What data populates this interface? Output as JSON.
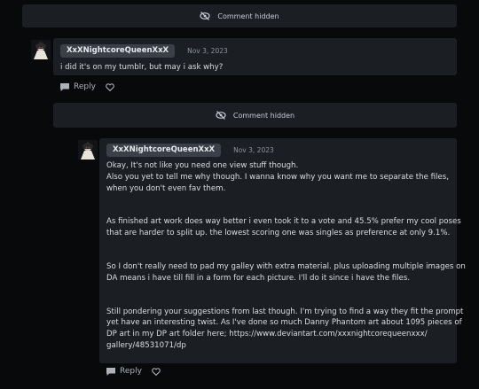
{
  "hidden_bar_1": {
    "label": "Comment hidden"
  },
  "comment_1": {
    "username": "XxXNightcoreQueenXxX",
    "date": "Nov 3, 2023",
    "text": "i did it's on my tumblr, but may i ask why?",
    "reply_label": "Reply"
  },
  "hidden_bar_2": {
    "label": "Comment hidden"
  },
  "comment_2": {
    "username": "XxXNightcoreQueenXxX",
    "date": "Nov 3, 2023",
    "paragraphs": [
      {
        "lines": [
          "Okay, It's not like you need one view stuff though.",
          "Also you yet to tell me why though. I wanna know why you want me to separate the files,",
          "when you don't even fav them."
        ]
      },
      {
        "lines": [
          "As finished art work does way better i even took it to a vote and 45.5% prefer my cool poses",
          "that are harder to split up. the lowest scoring one was singles as preference at only 9.1%."
        ]
      },
      {
        "lines": [
          "So I don't really need to pad my galley with extra material. plus uploading multiple images on",
          "DA means i have till fill in a form for each picture.  I'll do it since i have the files."
        ]
      },
      {
        "lines": [
          "Still pondering your suggestions from last though. I'm trying to find a way they fit the prompt",
          "yet have an interesting twist. As I've done so much Danny Phantom art about 1095 pieces of",
          "DP art in my DP art folder here; https://www.deviantart.com/xxxnightcorequeenxxx/",
          "gallery/48531071/dp"
        ]
      }
    ],
    "reply_label": "Reply"
  },
  "icons": {
    "hidden": "eye-slash-icon",
    "reply": "speech-bubble-icon",
    "like": "heart-icon"
  },
  "colors": {
    "background": "#08090b",
    "card": "#1b1e23",
    "badge": "#3a3f48"
  }
}
